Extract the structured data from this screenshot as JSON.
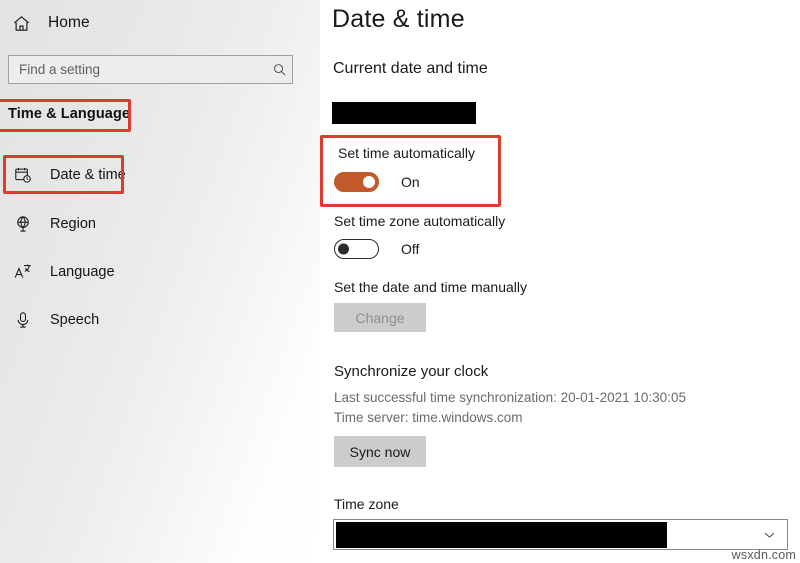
{
  "sidebar": {
    "home": {
      "label": "Home",
      "icon": "home-icon"
    },
    "search": {
      "placeholder": "Find a setting",
      "value": "",
      "icon": "search-icon"
    },
    "category_title": "Time & Language",
    "items": [
      {
        "label": "Date & time",
        "icon": "calendar-clock-icon",
        "selected": true
      },
      {
        "label": "Region",
        "icon": "globe-icon",
        "selected": false
      },
      {
        "label": "Language",
        "icon": "language-icon",
        "selected": false
      },
      {
        "label": "Speech",
        "icon": "microphone-icon",
        "selected": false
      }
    ]
  },
  "main": {
    "page_title": "Date & time",
    "current_section": {
      "heading": "Current date and time",
      "value": "",
      "redacted": true
    },
    "set_time_automatically": {
      "label": "Set time automatically",
      "state": "On",
      "on": true
    },
    "set_time_zone_automatically": {
      "label": "Set time zone automatically",
      "state": "Off",
      "on": false
    },
    "set_manually": {
      "label": "Set the date and time manually",
      "button_label": "Change",
      "disabled": true
    },
    "synchronize": {
      "heading": "Synchronize your clock",
      "last_sync": "Last successful time synchronization: 20-01-2021 10:30:05",
      "time_server": "Time server: time.windows.com",
      "button_label": "Sync now"
    },
    "time_zone": {
      "heading": "Time zone",
      "value": "",
      "redacted": true,
      "chevron": "chevron-down-icon"
    }
  },
  "annotations": {
    "highlight_color": "#de3b30",
    "boxes": [
      {
        "name": "time-language-highlight"
      },
      {
        "name": "date-time-highlight"
      },
      {
        "name": "set-time-automatically-highlight"
      }
    ]
  },
  "watermark": {
    "text": "wsxdn.com"
  }
}
